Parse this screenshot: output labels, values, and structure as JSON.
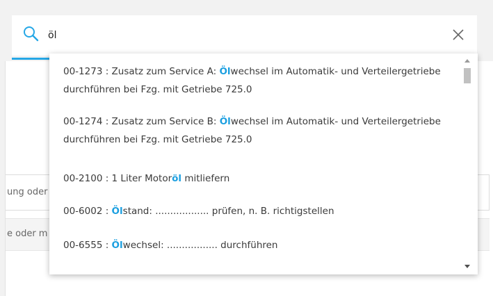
{
  "search": {
    "value": "öl",
    "clear_icon": "close-icon"
  },
  "background": {
    "field1_text": "ung oder",
    "field2_text": "e oder m"
  },
  "results": [
    {
      "code": "00-1273",
      "parts": [
        {
          "t": "00-1273 : Zusatz zum Service A: ",
          "h": false
        },
        {
          "t": "Öl",
          "h": true
        },
        {
          "t": "wechsel im Automatik- und Verteilergetriebe durchführen bei Fzg. mit Getriebe 725.0",
          "h": false
        }
      ]
    },
    {
      "code": "00-1274",
      "parts": [
        {
          "t": "00-1274 : Zusatz zum Service B: ",
          "h": false
        },
        {
          "t": "Öl",
          "h": true
        },
        {
          "t": "wechsel im Automatik- und Verteilergetriebe durchführen bei Fzg. mit Getriebe 725.0",
          "h": false
        }
      ]
    },
    {
      "code": "00-2100",
      "parts": [
        {
          "t": "00-2100 : 1 Liter Motor",
          "h": false
        },
        {
          "t": "öl",
          "h": true
        },
        {
          "t": " mitliefern",
          "h": false
        }
      ]
    },
    {
      "code": "00-6002",
      "parts": [
        {
          "t": "00-6002 : ",
          "h": false
        },
        {
          "t": "Öl",
          "h": true
        },
        {
          "t": "stand: .................. prüfen, n. B. richtigstellen",
          "h": false
        }
      ]
    },
    {
      "code": "00-6555",
      "parts": [
        {
          "t": "00-6555 : ",
          "h": false
        },
        {
          "t": "Öl",
          "h": true
        },
        {
          "t": "wechsel: ................. durchführen",
          "h": false
        }
      ]
    }
  ],
  "colors": {
    "accent": "#25a7e6",
    "highlight": "#1b9fe0"
  }
}
